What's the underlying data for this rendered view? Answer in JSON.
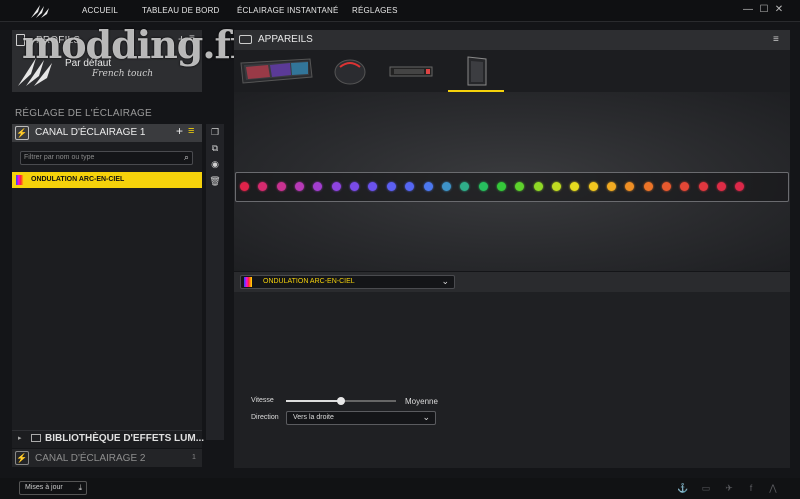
{
  "nav": {
    "items": [
      "ACCUEIL",
      "TABLEAU DE BORD",
      "ÉCLAIRAGE INSTANTANÉ",
      "RÉGLAGES"
    ]
  },
  "window": {
    "minimize": "—",
    "maximize": "☐",
    "close": "✕"
  },
  "watermark": "modding.fr",
  "profiles": {
    "title": "PROFILS",
    "profile_name": "Par défaut",
    "profile_signature": "French touch"
  },
  "lighting": {
    "section_title": "RÉGLAGE DE L'ÉCLAIRAGE",
    "channel1": "CANAL D'ÉCLAIRAGE 1",
    "filter_placeholder": "Filtrer par nom ou type",
    "effect_item": "ONDULATION ARC-EN-CIEL",
    "library": "BIBLIOTHÈQUE D'EFFETS LUM...",
    "channel2": "CANAL D'ÉCLAIRAGE 2",
    "channel2_count": "1"
  },
  "devices": {
    "title": "APPAREILS",
    "list": [
      "keyboard",
      "mouse",
      "memory",
      "case"
    ],
    "selected_index": 3
  },
  "leds": {
    "colors": [
      "#e0234a",
      "#d62a6e",
      "#c93291",
      "#b73ab7",
      "#a23ed0",
      "#8e44e0",
      "#7a4be8",
      "#6b52ee",
      "#5c5ff2",
      "#5566f3",
      "#4c78f0",
      "#3e93c8",
      "#2fae8a",
      "#27bf5e",
      "#35c93a",
      "#5ed22c",
      "#8fd826",
      "#c0dc22",
      "#e6dc1f",
      "#f2c71f",
      "#f2ab22",
      "#ef8f24",
      "#ec7428",
      "#e8592e",
      "#e44736",
      "#e1373f",
      "#de2c46",
      "#dc2849"
    ]
  },
  "effect": {
    "selected": "ONDULATION ARC-EN-CIEL",
    "speed_label": "Vitesse",
    "speed_value": "Moyenne",
    "speed_level": 0.5,
    "direction_label": "Direction",
    "direction_value": "Vers la droite"
  },
  "footer": {
    "update_label": "Mises à jour",
    "social": [
      "corsair-icon",
      "chat-icon",
      "twitter-icon",
      "facebook-icon",
      "corsair-logo-icon"
    ]
  },
  "colors": {
    "accent": "#f5d20b",
    "background": "#141518"
  }
}
